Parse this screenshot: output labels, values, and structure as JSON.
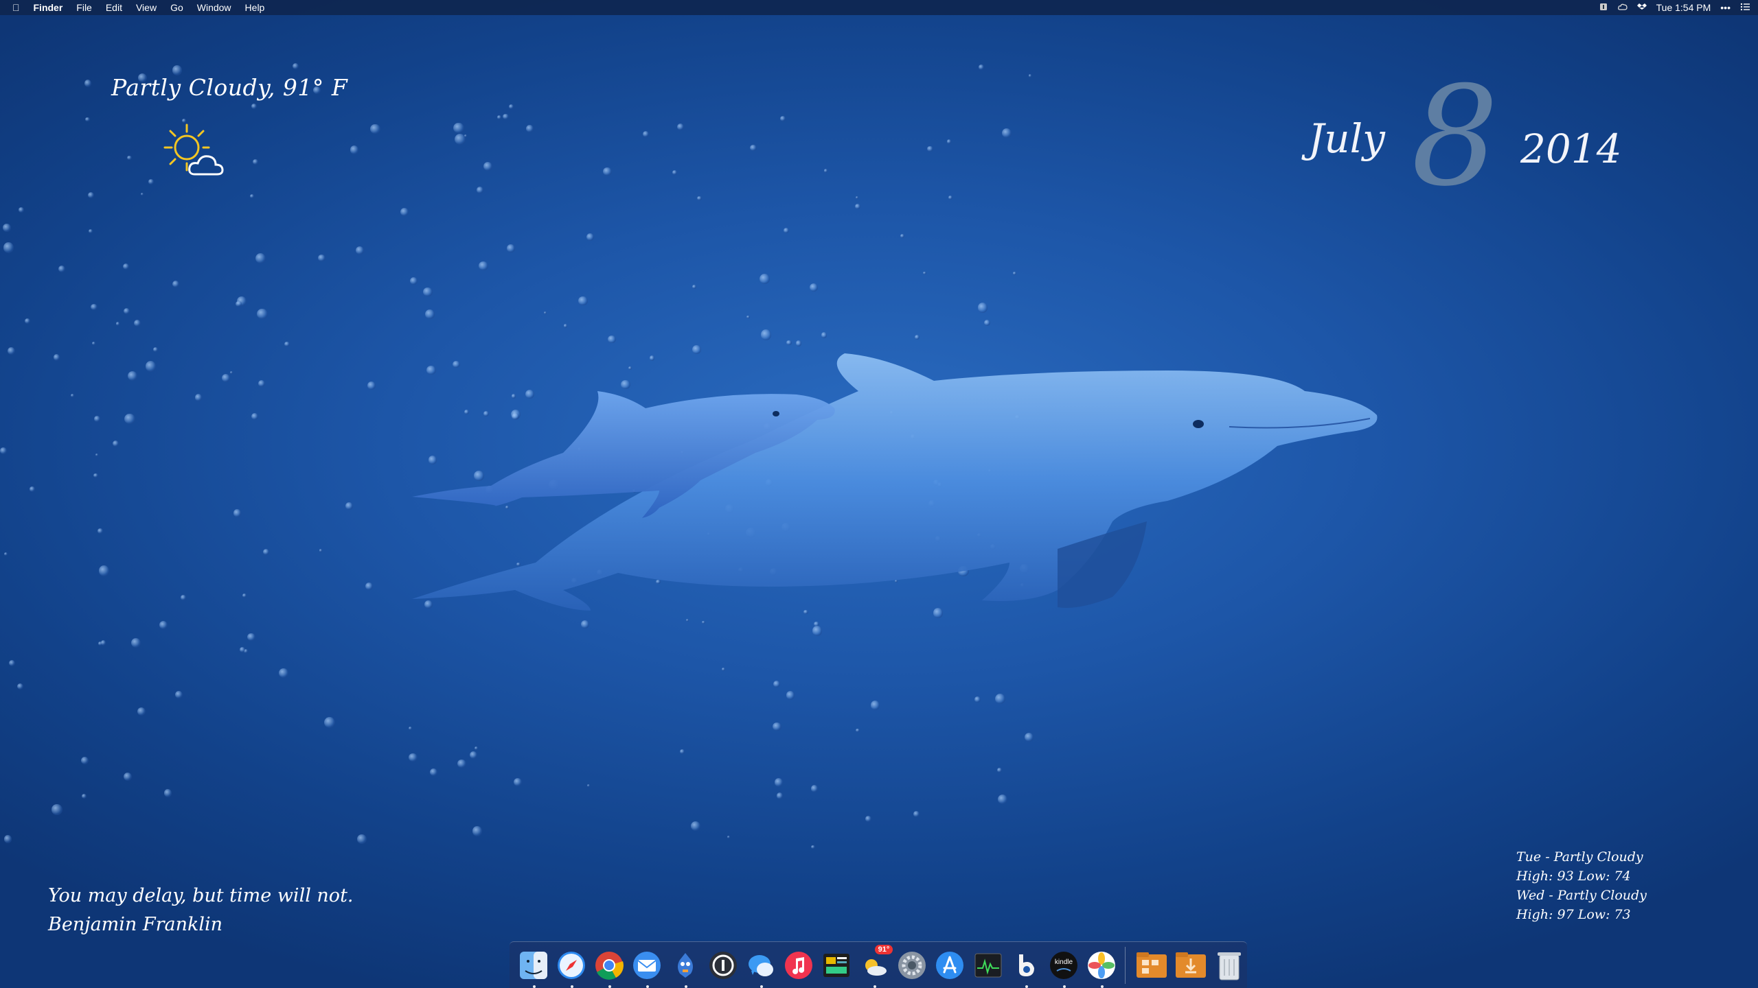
{
  "menubar": {
    "app_name": "Finder",
    "menus": [
      "File",
      "Edit",
      "View",
      "Go",
      "Window",
      "Help"
    ],
    "clock": "Tue 1:54 PM",
    "status_icons": [
      "notification-icon",
      "creative-cloud-icon",
      "dropbox-icon",
      "more-icon",
      "list-icon"
    ]
  },
  "weather": {
    "current": "Partly Cloudy, 91° F",
    "icon": "partly-cloudy-icon"
  },
  "date": {
    "month": "July",
    "day": "8",
    "year": "2014"
  },
  "quote": {
    "text": "You may delay, but time will not.",
    "author": "Benjamin Franklin"
  },
  "forecast": {
    "lines": [
      "Tue - Partly Cloudy",
      "High: 93 Low: 74",
      "Wed - Partly Cloudy",
      "High: 97 Low: 73"
    ]
  },
  "dock": {
    "apps": [
      {
        "name": "finder-icon",
        "running": true
      },
      {
        "name": "safari-icon",
        "running": true
      },
      {
        "name": "chrome-icon",
        "running": true
      },
      {
        "name": "mail-icon",
        "running": true
      },
      {
        "name": "tweetbot-icon",
        "running": true
      },
      {
        "name": "1password-icon",
        "running": false
      },
      {
        "name": "messages-icon",
        "running": true
      },
      {
        "name": "itunes-icon",
        "running": false
      },
      {
        "name": "reeder-icon",
        "running": false
      },
      {
        "name": "weather-app-icon",
        "running": true,
        "badge": "91°"
      },
      {
        "name": "system-preferences-icon",
        "running": false
      },
      {
        "name": "app-store-icon",
        "running": false
      },
      {
        "name": "activity-monitor-icon",
        "running": false
      },
      {
        "name": "bee-icon",
        "running": true
      },
      {
        "name": "kindle-icon",
        "running": true
      },
      {
        "name": "photos-icon",
        "running": true
      }
    ],
    "stacks": [
      "applications-folder-icon",
      "downloads-folder-icon",
      "trash-icon"
    ],
    "colors": {
      "accent": "#1d56a8"
    }
  }
}
